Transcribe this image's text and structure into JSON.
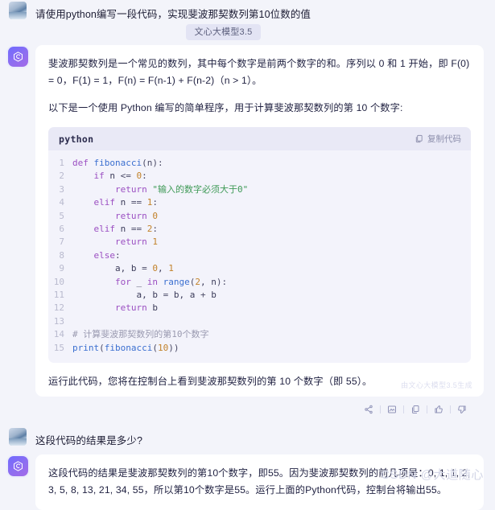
{
  "conversation": {
    "user_question_1": "请使用python编写一段代码，实现斐波那契数列第10位数的值",
    "model_badge": "文心大模型3.5",
    "answer_1": {
      "paragraph_1": "斐波那契数列是一个常见的数列，其中每个数字是前两个数字的和。序列以 0 和 1 开始，即 F(0) = 0，F(1) = 1，F(n) = F(n-1) + F(n-2)（n > 1）。",
      "paragraph_2": "以下是一个使用 Python 编写的简单程序，用于计算斐波那契数列的第 10 个数字:",
      "paragraph_3": "运行此代码，您将在控制台上看到斐波那契数列的第 10 个数字（即 55）。",
      "watermark": "由文心大模型3.5生成"
    },
    "code_block": {
      "language": "python",
      "copy_label": "复制代码",
      "line_numbers": [
        "1",
        "2",
        "3",
        "4",
        "5",
        "6",
        "7",
        "8",
        "9",
        "10",
        "11",
        "12",
        "13",
        "14",
        "15"
      ],
      "lines": [
        "def fibonacci(n):",
        "    if n <= 0:",
        "        return \"输入的数字必须大于0\"",
        "    elif n == 1:",
        "        return 0",
        "    elif n == 2:",
        "        return 1",
        "    else:",
        "        a, b = 0, 1",
        "        for _ in range(2, n):",
        "            a, b = b, a + b",
        "        return b",
        "",
        "# 计算斐波那契数列的第10个数字",
        "print(fibonacci(10))"
      ]
    },
    "actions": [
      {
        "name": "share-icon",
        "label": "分享"
      },
      {
        "name": "poster-icon",
        "label": "生成图片"
      },
      {
        "name": "copy-icon",
        "label": "复制"
      },
      {
        "name": "thumbs-up-icon",
        "label": "赞"
      },
      {
        "name": "thumbs-down-icon",
        "label": "踩"
      }
    ],
    "user_question_2": "这段代码的结果是多少?",
    "answer_2": {
      "paragraph_1": "这段代码的结果是斐波那契数列的第10个数字，即55。因为斐波那契数列的前几项是：0, 1, 1, 2, 3, 5, 8, 13, 21, 34, 55，所以第10个数字是55。运行上面的Python代码，控制台将输出55。"
    }
  },
  "page_watermark": "CSDN @大道随心",
  "colors": {
    "page_bg": "#f3f4fa",
    "bubble_bg": "#ffffff",
    "code_bg": "#f3f3fb",
    "code_head_bg": "#e9e9f6",
    "badge_bg": "#e3e4f4",
    "accent": "#7b6bf0"
  }
}
